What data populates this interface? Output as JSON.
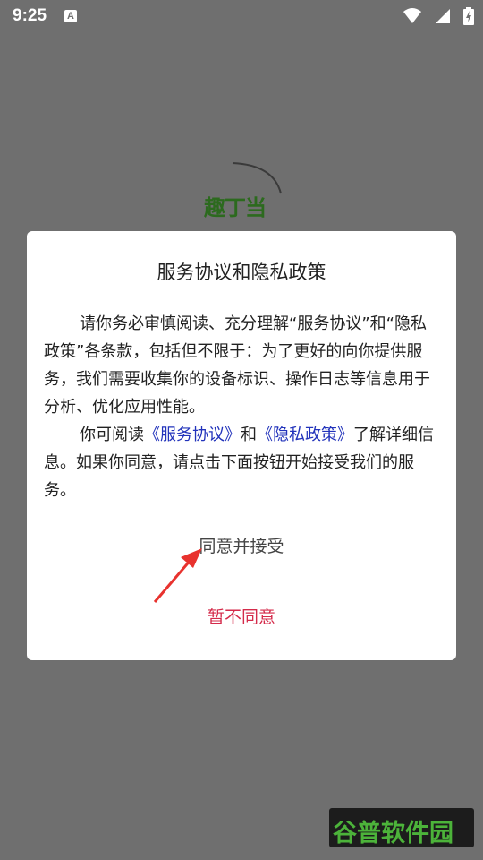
{
  "status_bar": {
    "time": "9:25",
    "notification_icon_letter": "A",
    "icons": [
      "wifi-icon",
      "signal-icon",
      "battery-charging-icon"
    ]
  },
  "splash": {
    "logo_text": "趣丁当"
  },
  "dialog": {
    "title": "服务协议和隐私政策",
    "paragraph1": "请你务必审慎阅读、充分理解“服务协议”和“隐私政策”各条款，包括但不限于：为了更好的向你提供服务，我们需要收集你的设备标识、操作日志等信息用于分析、优化应用性能。",
    "paragraph2_pre": "你可阅读",
    "link_service": "《服务协议》",
    "paragraph2_mid": "和",
    "link_privacy": "《隐私政策》",
    "paragraph2_post": "了解详细信息。如果你同意，请点击下面按钮开始接受我们的服务。",
    "accept_label": "同意并接受",
    "decline_label": "暂不同意"
  },
  "watermark": {
    "text": "谷普软件园"
  },
  "colors": {
    "overlay": "#6f6f6f",
    "link": "#2233bb",
    "decline": "#d42a4a",
    "arrow": "#e8322e",
    "watermark_text": "#4cb33a"
  }
}
